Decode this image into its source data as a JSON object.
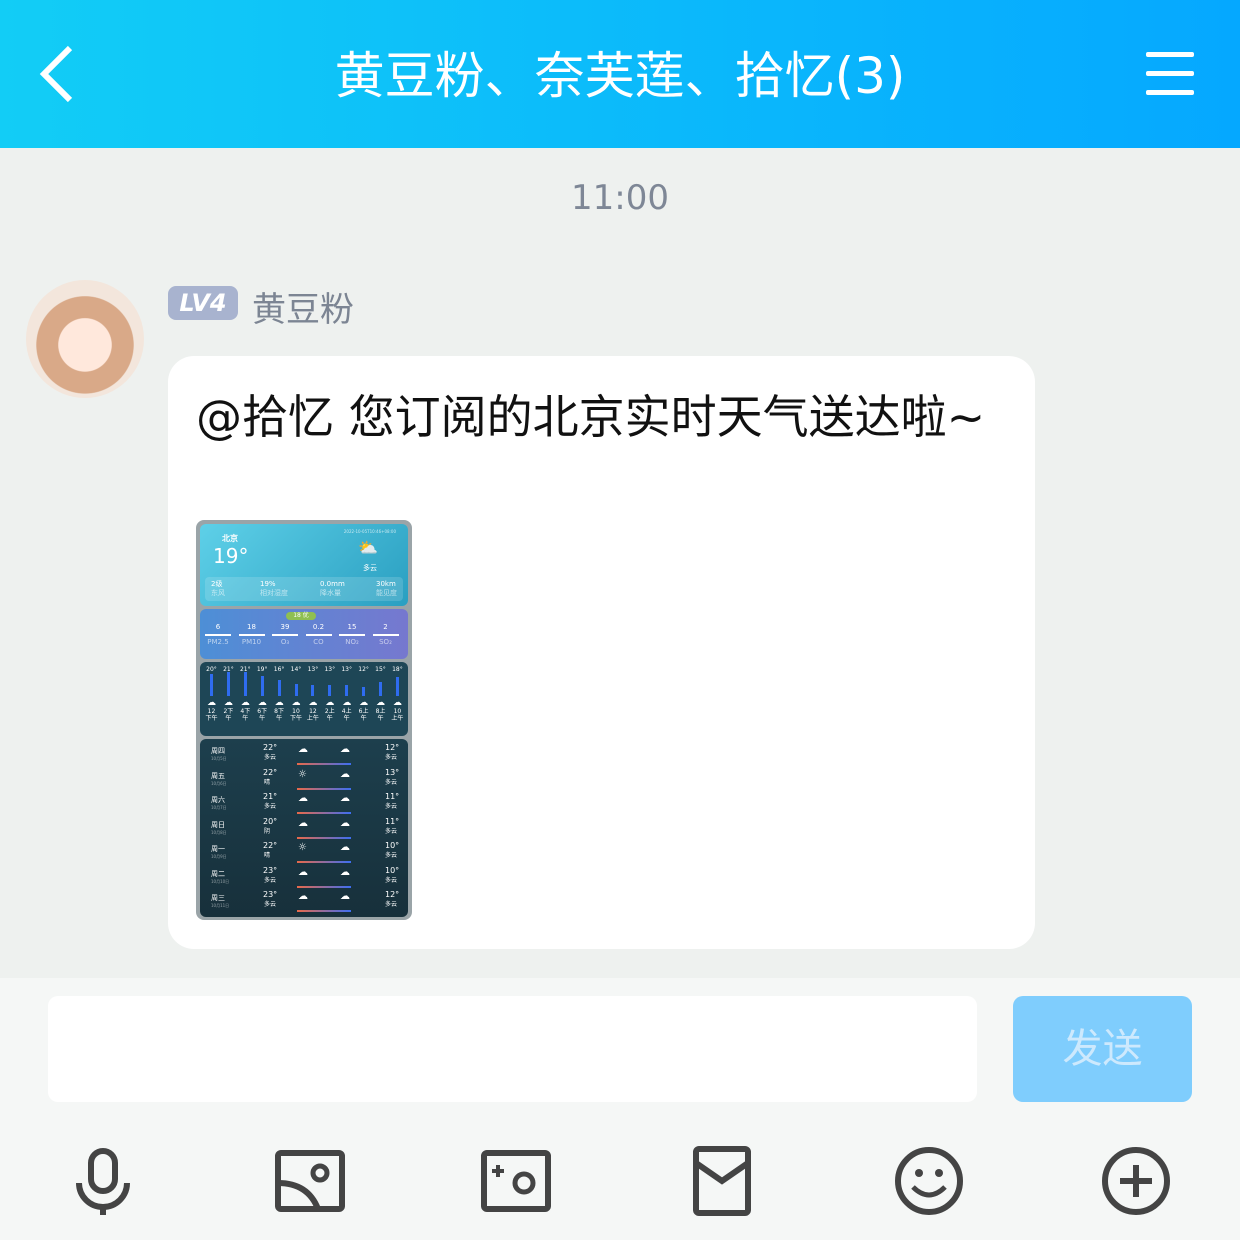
{
  "header": {
    "title": "黄豆粉、奈芙莲、拾忆(3)",
    "back_icon": "chevron-left-icon",
    "menu_icon": "hamburger-menu-icon"
  },
  "timestamp": "11:00",
  "message": {
    "level": "LV4",
    "sender": "黄豆粉",
    "text": "@拾忆 您订阅的北京实时天气送达啦~",
    "weather_card": {
      "city": "北京",
      "updated": "2022-10-05T10:46+08:00",
      "temperature": "19°",
      "condition": "多云",
      "stats": [
        {
          "value": "2级",
          "label": "东风"
        },
        {
          "value": "19%",
          "label": "相对湿度"
        },
        {
          "value": "0.0mm",
          "label": "降水量"
        },
        {
          "value": "30km",
          "label": "能见度"
        }
      ],
      "aqi_badge": "18 优",
      "air": [
        {
          "value": "6",
          "label": "PM2.5"
        },
        {
          "value": "18",
          "label": "PM10"
        },
        {
          "value": "39",
          "label": "O₃"
        },
        {
          "value": "0.2",
          "label": "CO"
        },
        {
          "value": "15",
          "label": "NO₂"
        },
        {
          "value": "2",
          "label": "SO₂"
        }
      ],
      "hourly": [
        {
          "t": "20°",
          "v": 20,
          "time": "12",
          "ap": "下午"
        },
        {
          "t": "21°",
          "v": 21,
          "time": "2下",
          "ap": "午"
        },
        {
          "t": "21°",
          "v": 21,
          "time": "4下",
          "ap": "午"
        },
        {
          "t": "19°",
          "v": 19,
          "time": "6下",
          "ap": "午"
        },
        {
          "t": "16°",
          "v": 16,
          "time": "8下",
          "ap": "午"
        },
        {
          "t": "14°",
          "v": 14,
          "time": "10",
          "ap": "下午"
        },
        {
          "t": "13°",
          "v": 13,
          "time": "12",
          "ap": "上午"
        },
        {
          "t": "13°",
          "v": 13,
          "time": "2上",
          "ap": "午"
        },
        {
          "t": "13°",
          "v": 13,
          "time": "4上",
          "ap": "午"
        },
        {
          "t": "12°",
          "v": 12,
          "time": "6上",
          "ap": "午"
        },
        {
          "t": "15°",
          "v": 15,
          "time": "8上",
          "ap": "午"
        },
        {
          "t": "18°",
          "v": 18,
          "time": "10",
          "ap": "上午"
        }
      ],
      "daily": [
        {
          "day": "周四",
          "date": "10月5日",
          "hi": "22°",
          "hi_cond": "多云",
          "lo": "12°",
          "lo_cond": "多云"
        },
        {
          "day": "周五",
          "date": "10月6日",
          "hi": "22°",
          "hi_cond": "晴",
          "lo": "13°",
          "lo_cond": "多云"
        },
        {
          "day": "周六",
          "date": "10月7日",
          "hi": "21°",
          "hi_cond": "多云",
          "lo": "11°",
          "lo_cond": "多云"
        },
        {
          "day": "周日",
          "date": "10月8日",
          "hi": "20°",
          "hi_cond": "阴",
          "lo": "11°",
          "lo_cond": "多云"
        },
        {
          "day": "周一",
          "date": "10月9日",
          "hi": "22°",
          "hi_cond": "晴",
          "lo": "10°",
          "lo_cond": "多云"
        },
        {
          "day": "周二",
          "date": "10月10日",
          "hi": "23°",
          "hi_cond": "多云",
          "lo": "10°",
          "lo_cond": "多云"
        },
        {
          "day": "周三",
          "date": "10月11日",
          "hi": "23°",
          "hi_cond": "多云",
          "lo": "12°",
          "lo_cond": "多云"
        }
      ]
    }
  },
  "composer": {
    "input_value": "",
    "send_label": "发送"
  },
  "toolbar": [
    "microphone-icon",
    "image-icon",
    "camera-icon",
    "red-packet-icon",
    "emoji-icon",
    "plus-icon"
  ]
}
